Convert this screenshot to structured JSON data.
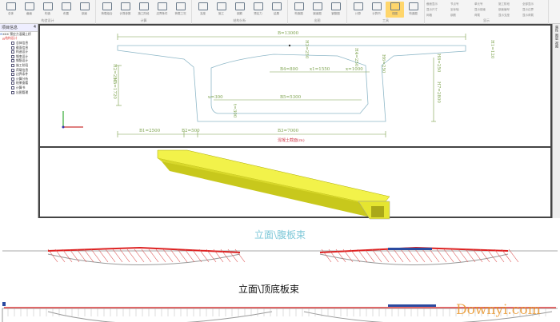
{
  "toolbar": {
    "groups": [
      {
        "label": "构造设计",
        "tools": [
          "总体",
          "截面",
          "构造",
          "布置",
          "钢束"
        ]
      },
      {
        "label": "计算",
        "tools": [
          "荷载组合",
          "计算参数",
          "施工阶段",
          "边界条件",
          "荷载工况"
        ]
      },
      {
        "label": "结构分析",
        "tools": [
          "支座",
          "施工",
          "钢筋",
          "预应力",
          "结果"
        ]
      },
      {
        "label": "出图",
        "tools": [
          "构造图",
          "钢束图",
          "钢筋图"
        ]
      },
      {
        "label": "工具",
        "tools": [
          "计算",
          "计算书",
          "视图",
          "构造图"
        ],
        "selected": "视图"
      }
    ],
    "display": {
      "label": "显示",
      "items": [
        "截面显示",
        "节点号",
        "单元号",
        "施工阶段",
        "全部显示",
        "显示尺寸",
        "坐标轴",
        "显示钢束",
        "钢束编号",
        "显示边界",
        "网格",
        "钢筋",
        "荷载",
        "显示支座",
        "显示荷载"
      ],
      "checkbox": "网格"
    }
  },
  "left_panel": {
    "title": "项目信息",
    "pin": "4",
    "root": "XXX 预应力混凝土桥",
    "node": "结构设计",
    "items": [
      "总体信息",
      "截面信息",
      "构造设计",
      "钢束设计",
      "钢筋设计",
      "施工阶段",
      "荷载信息",
      "边界条件",
      "计算分析",
      "结果查看",
      "计算书",
      "出图管理"
    ]
  },
  "section": {
    "dims": {
      "B": "B=13000",
      "B1": "B1=2500",
      "B2": "B2=500",
      "B3": "B3=7000",
      "B4": "B4=800",
      "x1": "x1=1550",
      "x": "x=1000",
      "B5": "B5=5300",
      "u": "u=300",
      "H1": "H1=120",
      "H2": "H2=250",
      "H3": "H3=250",
      "H4": "H4=250",
      "H5": "H5=1720",
      "H6": "H6=250",
      "H7": "H7=2800",
      "H8": "H8=250",
      "t": "t=300",
      "dot": "t=300"
    },
    "caption": "混凝土截面(m)",
    "colors": {
      "outline": "#8fb8c8",
      "dim": "#7aa04a",
      "caption": "#d04050"
    }
  },
  "beam3d": {
    "color": "#e8e830"
  },
  "right_tabs": [
    "属性",
    "图层",
    "视图"
  ],
  "elevation1": {
    "title": "立面\\腹板束",
    "color": "#7ec8d8"
  },
  "elevation2": {
    "title": "立面\\顶底板束"
  },
  "watermark": "Downyi.com"
}
